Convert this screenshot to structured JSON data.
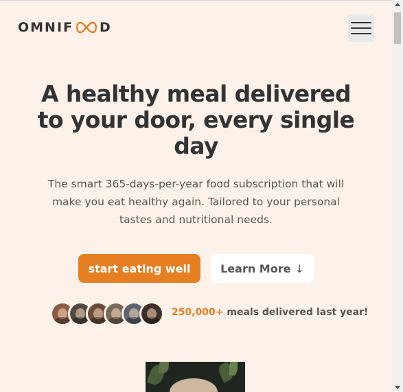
{
  "header": {
    "logo_prefix": "OMNIF",
    "logo_suffix": "D",
    "brand_color": "#e67e22",
    "menu_icon": "hamburger-menu-icon"
  },
  "hero": {
    "title": "A healthy meal delivered to your door, every single day",
    "description": "The smart 365-days-per-year food subscription that will make you eat healthy again. Tailored to your personal tastes and nutritional needs.",
    "primary_cta": "start eating well",
    "secondary_cta": "Learn More",
    "secondary_cta_arrow": "↓"
  },
  "delivered": {
    "count": "250,000+",
    "text": "meals delivered last year!",
    "avatars": [
      {
        "name": "customer-avatar-1",
        "color": "#8a5a44"
      },
      {
        "name": "customer-avatar-2",
        "color": "#4f4a44"
      },
      {
        "name": "customer-avatar-3",
        "color": "#6b4c3b"
      },
      {
        "name": "customer-avatar-4",
        "color": "#7a6a5a"
      },
      {
        "name": "customer-avatar-5",
        "color": "#5b6470"
      },
      {
        "name": "customer-avatar-6",
        "color": "#3e2f28"
      }
    ]
  },
  "colors": {
    "background": "#fdf2e9",
    "accent": "#e67e22",
    "text": "#333333"
  }
}
